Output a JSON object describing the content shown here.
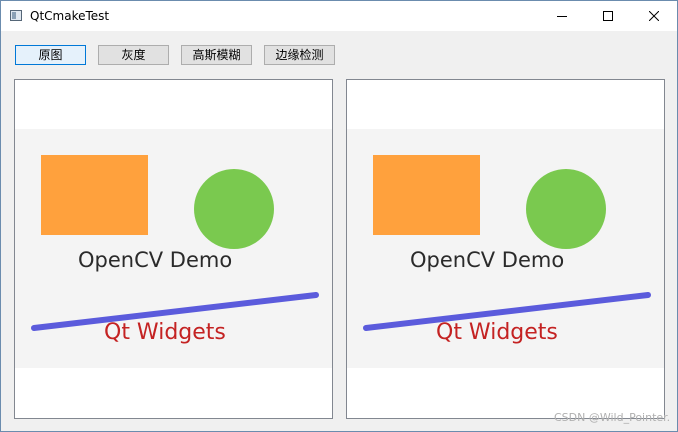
{
  "window": {
    "title": "QtCmakeTest"
  },
  "toolbar": {
    "buttons": [
      {
        "label": "原图",
        "active": true
      },
      {
        "label": "灰度",
        "active": false
      },
      {
        "label": "高斯模糊",
        "active": false
      },
      {
        "label": "边缘检测",
        "active": false
      }
    ]
  },
  "image": {
    "text_opencv": "OpenCV Demo",
    "text_qt": "Qt Widgets",
    "colors": {
      "rect": "#ffa13d",
      "circle": "#7ac94f",
      "line": "#5b5bdc",
      "text_opencv": "#2a2a2a",
      "text_qt": "#c42222",
      "band": "#f4f4f4"
    }
  },
  "watermark": "CSDN @Wild_Pointer."
}
